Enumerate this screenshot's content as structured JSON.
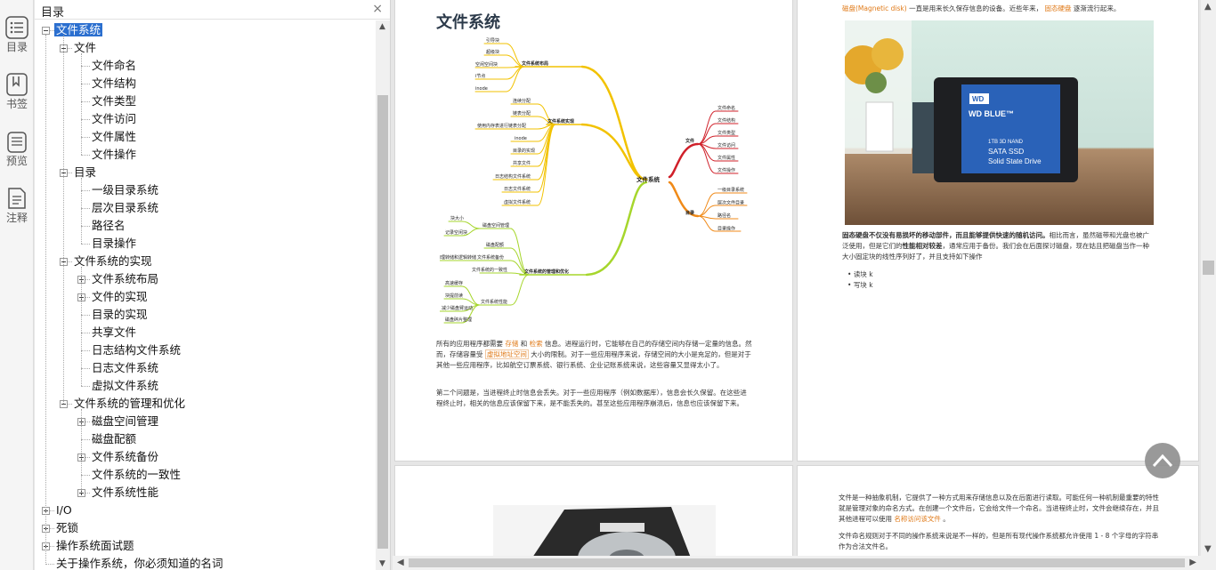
{
  "sidebar_strip": [
    {
      "label": "目录",
      "icon": "list-icon"
    },
    {
      "label": "书签",
      "icon": "bookmark-icon"
    },
    {
      "label": "预览",
      "icon": "preview-icon"
    },
    {
      "label": "注释",
      "icon": "note-icon"
    }
  ],
  "toc": {
    "title": "目录",
    "close": "×",
    "items": [
      {
        "label": "文件系统",
        "level": 0,
        "state": "open",
        "selected": true
      },
      {
        "label": "文件",
        "level": 1,
        "state": "open"
      },
      {
        "label": "文件命名",
        "level": 2,
        "state": "leaf"
      },
      {
        "label": "文件结构",
        "level": 2,
        "state": "leaf"
      },
      {
        "label": "文件类型",
        "level": 2,
        "state": "leaf"
      },
      {
        "label": "文件访问",
        "level": 2,
        "state": "leaf"
      },
      {
        "label": "文件属性",
        "level": 2,
        "state": "leaf"
      },
      {
        "label": "文件操作",
        "level": 2,
        "state": "leaf"
      },
      {
        "label": "目录",
        "level": 1,
        "state": "open"
      },
      {
        "label": "一级目录系统",
        "level": 2,
        "state": "leaf"
      },
      {
        "label": "层次目录系统",
        "level": 2,
        "state": "leaf"
      },
      {
        "label": "路径名",
        "level": 2,
        "state": "leaf"
      },
      {
        "label": "目录操作",
        "level": 2,
        "state": "leaf"
      },
      {
        "label": "文件系统的实现",
        "level": 1,
        "state": "open"
      },
      {
        "label": "文件系统布局",
        "level": 2,
        "state": "closed"
      },
      {
        "label": "文件的实现",
        "level": 2,
        "state": "closed"
      },
      {
        "label": "目录的实现",
        "level": 2,
        "state": "leaf"
      },
      {
        "label": "共享文件",
        "level": 2,
        "state": "leaf"
      },
      {
        "label": "日志结构文件系统",
        "level": 2,
        "state": "leaf"
      },
      {
        "label": "日志文件系统",
        "level": 2,
        "state": "leaf"
      },
      {
        "label": "虚拟文件系统",
        "level": 2,
        "state": "leaf"
      },
      {
        "label": "文件系统的管理和优化",
        "level": 1,
        "state": "open"
      },
      {
        "label": "磁盘空间管理",
        "level": 2,
        "state": "closed"
      },
      {
        "label": "磁盘配额",
        "level": 2,
        "state": "leaf"
      },
      {
        "label": "文件系统备份",
        "level": 2,
        "state": "closed"
      },
      {
        "label": "文件系统的一致性",
        "level": 2,
        "state": "leaf"
      },
      {
        "label": "文件系统性能",
        "level": 2,
        "state": "closed"
      },
      {
        "label": "I/O",
        "level": 0,
        "state": "closed"
      },
      {
        "label": "死锁",
        "level": 0,
        "state": "closed"
      },
      {
        "label": "操作系统面试题",
        "level": 0,
        "state": "closed"
      },
      {
        "label": "关于操作系统，你必须知道的名词",
        "level": 0,
        "state": "leaf"
      }
    ]
  },
  "page1": {
    "heading": "文件系统",
    "para1": [
      {
        "t": "所有的应用程序都需要 "
      },
      {
        "t": "存储",
        "hl": 1
      },
      {
        "t": " 和 "
      },
      {
        "t": "检索",
        "hl": 1
      },
      {
        "t": " 信息。进程运行时，它能够在自己的存储空间内存储一定量的信息。然而，存储容量受 "
      },
      {
        "t": "虚拟地址空间",
        "hl": 2
      },
      {
        "t": " 大小的限制。对于一些应用程序来说，存储空间的大小是充足的，但是对于其他一些应用程序，比如航空订票系统、银行系统、企业记账系统来说，这些容量又显得太小了。"
      }
    ],
    "para2": "第二个问题是，当进程终止时信息会丢失。对于一些应用程序（例如数据库），信息会长久保留。在这些进程终止时，相关的信息应该保留下来，是不能丢失的。甚至这些应用程序崩溃后，信息也应该保留下来。"
  },
  "mindmap": {
    "root": "文件系统",
    "left_branches": [
      {
        "label": "文件系统布局",
        "color": "#f2c200",
        "children": [
          "引导块",
          "超级块",
          "空闲空间块",
          "i节点",
          "inode"
        ]
      },
      {
        "label": "文件系统实现",
        "color": "#f2c200",
        "children": [
          "连续分配",
          "链表分配",
          "使用内存表进行链表分配",
          "inode",
          "目录的实现",
          "共享文件",
          "日志结构文件系统",
          "日志文件系统",
          "虚拟文件系统"
        ]
      },
      {
        "label": "文件系统的管理和优化",
        "color": "#a6d62c",
        "children": [
          "磁盘空间管理",
          "磁盘配额",
          "文件系统备份",
          "文件系统的一致性",
          "文件系统性能"
        ]
      }
    ],
    "right_branches": [
      {
        "label": "文件",
        "color": "#d0202a",
        "children": [
          "文件命名",
          "文件结构",
          "文件类型",
          "文件访问",
          "文件属性",
          "文件操作"
        ]
      },
      {
        "label": "目录",
        "color": "#f08a18",
        "children": [
          "一级目录系统",
          "层次文件目录",
          "路径名",
          "目录操作"
        ]
      }
    ],
    "disk_space_sub": [
      "块大小",
      "记录空闲块"
    ],
    "backup_sub": [
      "物理转储和逻辑转储"
    ],
    "perf_sub": [
      "高速缓存",
      "块提前读",
      "减少磁盘臂运动",
      "磁盘碎片整理"
    ]
  },
  "page2": {
    "top_line": [
      {
        "t": "磁盘(Magnetic disk)",
        "hl": 1
      },
      {
        "t": " 一直是用来长久保存信息的设备。近些年来， "
      },
      {
        "t": "固态硬盘",
        "hl": 1
      },
      {
        "t": " 逐渐流行起来。"
      }
    ],
    "ssd_brand": "WD BLUE™",
    "ssd_line1": "1TB 3D NAND",
    "ssd_line2": "SATA SSD",
    "ssd_line3": "Solid State Drive",
    "para": [
      {
        "t": "固态硬盘不仅没有易损坏的移动部件，而且能够提供快速的随机访问。",
        "b": 1
      },
      {
        "t": "相比而言，虽然磁带和光盘也被广泛使用，但是它们的"
      },
      {
        "t": "性能相对较差",
        "b": 1
      },
      {
        "t": "，通常应用于备份。我们会在后面探讨磁盘，现在姑且把磁盘当作一种大小固定块的线性序列好了，并且支持如下操作"
      }
    ],
    "bullets": [
      "读块 k",
      "写块 k"
    ]
  },
  "page4": {
    "para1": [
      {
        "t": "文件是一种抽象机制，它提供了一种方式用来存储信息以及在后面进行读取。可能任何一种机制最重要的特性就是管理对象的命名方式。在创建一个文件后，它会给文件一个命名。当进程终止时，文件会继续存在，并且其他进程可以使用 "
      },
      {
        "t": "名称访问该文件",
        "hl": 1
      },
      {
        "t": " 。"
      }
    ],
    "para2": "文件命名规则对于不同的操作系统来说是不一样的，但是所有现代操作系统都允许使用 1 - 8 个字母的字符串作为合法文件名。"
  },
  "colors": {
    "selected": "#2b6fcf",
    "highlight": "#e07a18"
  }
}
